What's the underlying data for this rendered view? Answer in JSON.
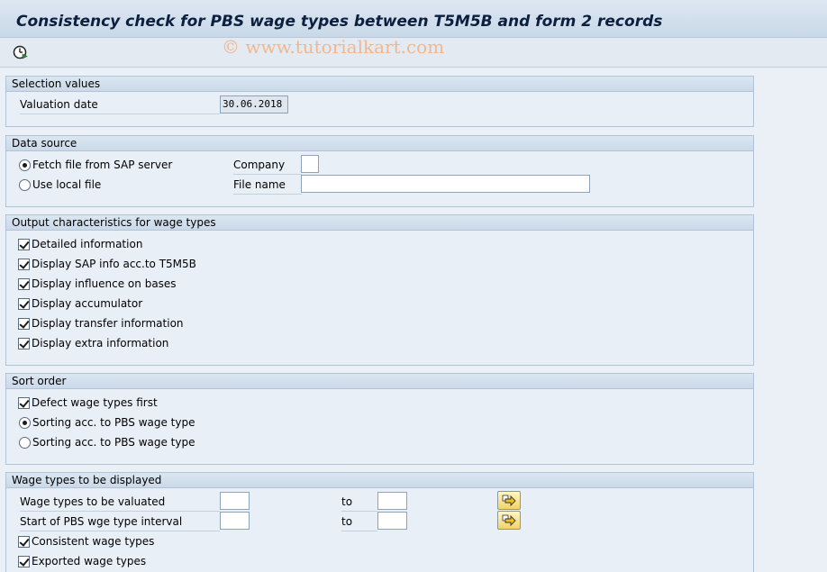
{
  "window": {
    "title": "Consistency check for PBS wage types between T5M5B and form 2 records",
    "watermark": "© www.tutorialkart.com"
  },
  "toolbar": {
    "execute_icon": "execute-clock-icon"
  },
  "selection_values": {
    "header": "Selection values",
    "valuation_date_label": "Valuation date",
    "valuation_date_value": "30.06.2018"
  },
  "data_source": {
    "header": "Data source",
    "fetch_label": "Fetch file from SAP server",
    "fetch_selected": true,
    "local_label": "Use local file",
    "local_selected": false,
    "company_label": "Company",
    "company_value": "",
    "filename_label": "File name",
    "filename_value": ""
  },
  "output": {
    "header": "Output characteristics for wage types",
    "items": [
      {
        "label": "Detailed information",
        "checked": true
      },
      {
        "label": "Display SAP info acc.to T5M5B",
        "checked": true
      },
      {
        "label": "Display influence on bases",
        "checked": true
      },
      {
        "label": "Display accumulator",
        "checked": true
      },
      {
        "label": "Display transfer information",
        "checked": true
      },
      {
        "label": "Display extra information",
        "checked": true
      }
    ]
  },
  "sort_order": {
    "header": "Sort order",
    "defect_label": "Defect wage types first",
    "defect_checked": true,
    "sort1_label": "Sorting acc. to PBS wage type",
    "sort1_selected": true,
    "sort2_label": "Sorting acc. to PBS wage type",
    "sort2_selected": false
  },
  "wage_types": {
    "header": "Wage types to be displayed",
    "valuated_label": "Wage types to be valuated",
    "interval_label": "Start of PBS wge type interval",
    "to_label": "to",
    "consistent_label": "Consistent wage types",
    "consistent_checked": true,
    "exported_label": "Exported wage types",
    "exported_checked": true
  }
}
